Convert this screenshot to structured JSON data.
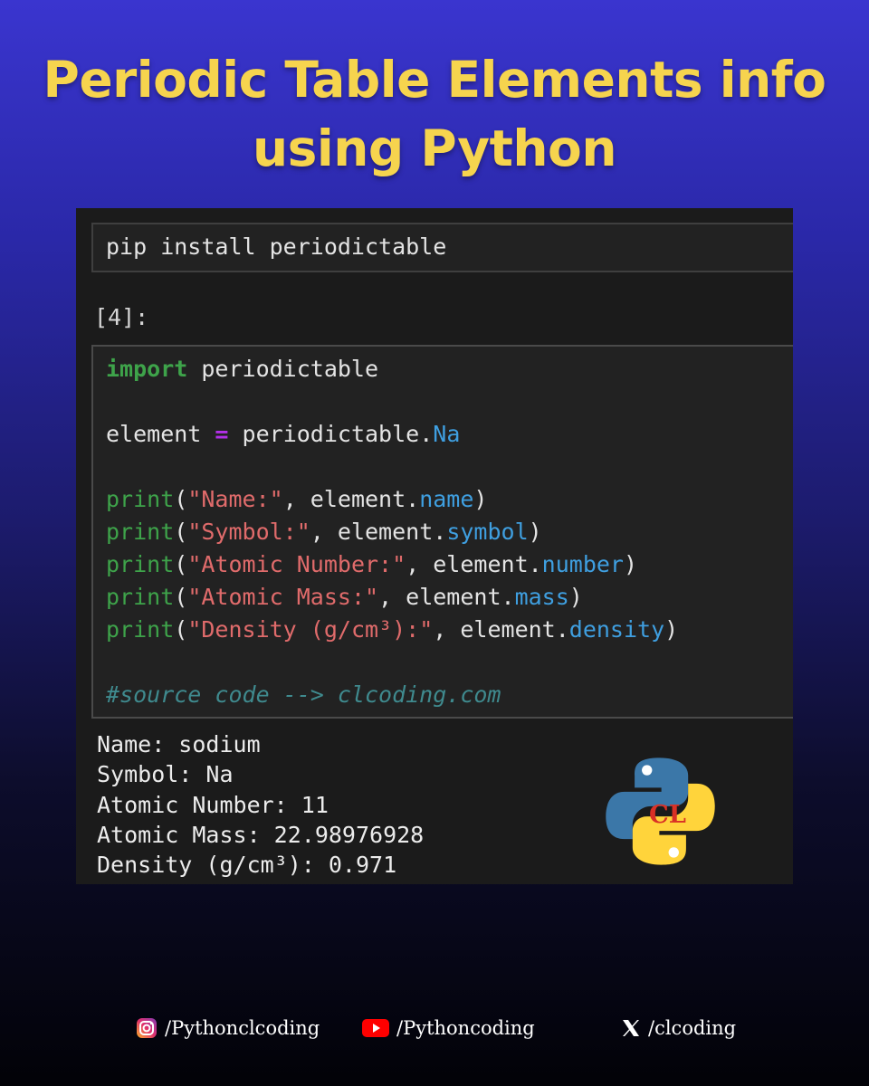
{
  "title": {
    "line1": "Periodic Table Elements info",
    "line2": "using Python",
    "color": "#f6d44e"
  },
  "cell_install": {
    "code": "pip install periodictable"
  },
  "cell_main": {
    "prompt": "[4]:",
    "import_keyword": "import",
    "import_module": " periodictable",
    "assign_var": "element ",
    "assign_op": "=",
    "assign_rhs": " periodictable.",
    "assign_attr": "Na",
    "prints": [
      {
        "fn": "print",
        "open": "(",
        "str": "\"Name:\"",
        "mid": ", element.",
        "attr": "name",
        "close": ")"
      },
      {
        "fn": "print",
        "open": "(",
        "str": "\"Symbol:\"",
        "mid": ", element.",
        "attr": "symbol",
        "close": ")"
      },
      {
        "fn": "print",
        "open": "(",
        "str": "\"Atomic Number:\"",
        "mid": ", element.",
        "attr": "number",
        "close": ")"
      },
      {
        "fn": "print",
        "open": "(",
        "str": "\"Atomic Mass:\"",
        "mid": ", element.",
        "attr": "mass",
        "close": ")"
      },
      {
        "fn": "print",
        "open": "(",
        "str": "\"Density (g/cm³):\"",
        "mid": ", element.",
        "attr": "density",
        "close": ")"
      }
    ],
    "comment": "#source code --> clcoding.com"
  },
  "output": [
    "Name: sodium",
    "Symbol: Na",
    "Atomic Number: 11",
    "Atomic Mass: 22.98976928",
    "Density (g/cm³): 0.971"
  ],
  "logo": {
    "icon": "python-logo-icon",
    "overlay_text": "CL",
    "colors": {
      "blue": "#3b77a8",
      "yellow": "#ffd43b",
      "red": "#d93025",
      "cl_blue": "#1a73e8"
    }
  },
  "socials": [
    {
      "icon": "instagram-icon",
      "label": "/Pythonclcoding"
    },
    {
      "icon": "youtube-icon",
      "label": "/Pythoncoding"
    },
    {
      "icon": "x-icon",
      "label": "/clcoding"
    }
  ],
  "colors": {
    "keyword": "#3ea34a",
    "operator": "#b230e8",
    "attribute": "#3f9fe0",
    "string": "#e06b6b",
    "comment": "#3f8a8e"
  }
}
